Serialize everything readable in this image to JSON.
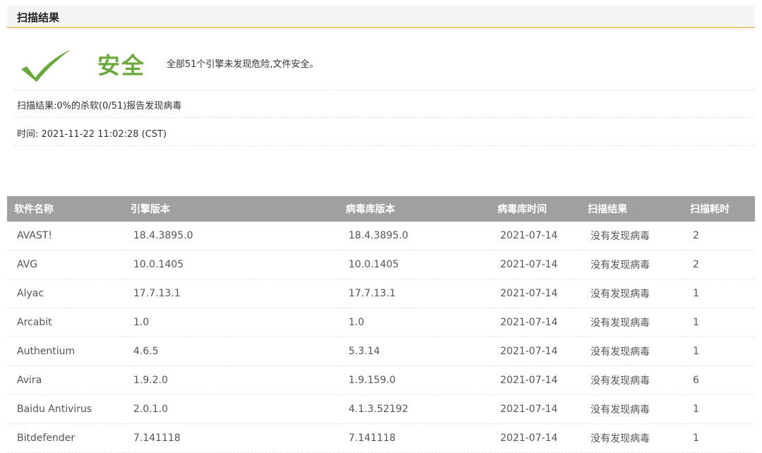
{
  "section": {
    "title": "扫描结果"
  },
  "verdict": {
    "label": "安全",
    "description": "全部51个引擎未发现危险,文件安全。",
    "accent_color": "#6aa83a",
    "icon": "check-icon"
  },
  "summary": {
    "result_line": "扫描结果:0%的杀软(0/51)报告发现病毒",
    "time_line": "时间: 2021-11-22 11:02:28 (CST)"
  },
  "table": {
    "headers": [
      "软件名称",
      "引擎版本",
      "病毒库版本",
      "病毒库时间",
      "扫描结果",
      "扫描耗时"
    ],
    "rows": [
      {
        "name": "AVAST!",
        "engine": "18.4.3895.0",
        "db": "18.4.3895.0",
        "date": "2021-07-14",
        "result": "没有发现病毒",
        "time": "2"
      },
      {
        "name": "AVG",
        "engine": "10.0.1405",
        "db": "10.0.1405",
        "date": "2021-07-14",
        "result": "没有发现病毒",
        "time": "2"
      },
      {
        "name": "Alyac",
        "engine": "17.7.13.1",
        "db": "17.7.13.1",
        "date": "2021-07-14",
        "result": "没有发现病毒",
        "time": "1"
      },
      {
        "name": "Arcabit",
        "engine": "1.0",
        "db": "1.0",
        "date": "2021-07-14",
        "result": "没有发现病毒",
        "time": "1"
      },
      {
        "name": "Authentium",
        "engine": "4.6.5",
        "db": "5.3.14",
        "date": "2021-07-14",
        "result": "没有发现病毒",
        "time": "1"
      },
      {
        "name": "Avira",
        "engine": "1.9.2.0",
        "db": "1.9.159.0",
        "date": "2021-07-14",
        "result": "没有发现病毒",
        "time": "6"
      },
      {
        "name": "Baidu Antivirus",
        "engine": "2.0.1.0",
        "db": "4.1.3.52192",
        "date": "2021-07-14",
        "result": "没有发现病毒",
        "time": "1"
      },
      {
        "name": "Bitdefender",
        "engine": "7.141118",
        "db": "7.141118",
        "date": "2021-07-14",
        "result": "没有发现病毒",
        "time": "1"
      }
    ]
  }
}
